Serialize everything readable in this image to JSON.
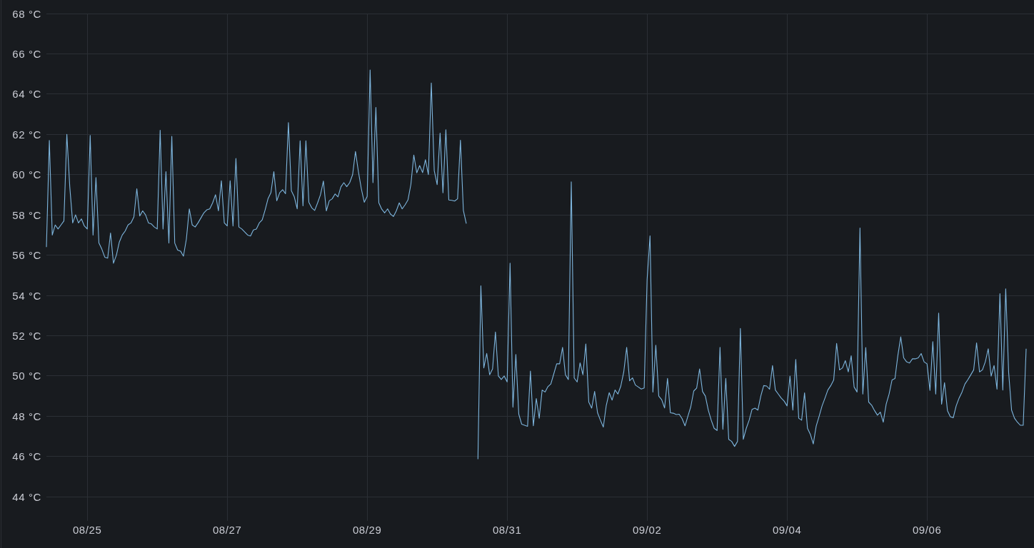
{
  "panel": {
    "chart_data": {
      "type": "line",
      "grid": true,
      "categories": [
        null,
        null,
        null,
        null,
        null,
        null,
        null,
        null,
        null,
        null,
        null,
        null,
        null,
        null,
        "08/25",
        null,
        null,
        null,
        null,
        null,
        null,
        null,
        null,
        null,
        null,
        null,
        null,
        null,
        null,
        null,
        null,
        null,
        null,
        null,
        null,
        null,
        null,
        null,
        null,
        null,
        null,
        null,
        null,
        null,
        null,
        null,
        null,
        null,
        null,
        null,
        null,
        null,
        null,
        null,
        null,
        null,
        null,
        null,
        null,
        null,
        null,
        null,
        "08/27",
        null,
        null,
        null,
        null,
        null,
        null,
        null,
        null,
        null,
        null,
        null,
        null,
        null,
        null,
        null,
        null,
        null,
        null,
        null,
        null,
        null,
        null,
        null,
        null,
        null,
        null,
        null,
        null,
        null,
        null,
        null,
        null,
        null,
        null,
        null,
        null,
        null,
        null,
        null,
        null,
        null,
        null,
        null,
        null,
        null,
        null,
        null,
        "08/29",
        null,
        null,
        null,
        null,
        null,
        null,
        null,
        null,
        null,
        null,
        null,
        null,
        null,
        null,
        null,
        null,
        null,
        null,
        null,
        null,
        null,
        null,
        null,
        null,
        null,
        null,
        null,
        null,
        null,
        null,
        null,
        null,
        null,
        null,
        null,
        null,
        null,
        null,
        null,
        null,
        null,
        null,
        null,
        null,
        null,
        null,
        null,
        "08/31",
        null,
        null,
        null,
        null,
        null,
        null,
        null,
        null,
        null,
        null,
        null,
        null,
        null,
        null,
        null,
        null,
        null,
        null,
        null,
        null,
        null,
        null,
        null,
        null,
        null,
        null,
        null,
        null,
        null,
        null,
        null,
        null,
        null,
        null,
        null,
        null,
        null,
        null,
        null,
        null,
        null,
        null,
        null,
        null,
        null,
        null,
        null,
        "09/02",
        null,
        null,
        null,
        null,
        null,
        null,
        null,
        null,
        null,
        null,
        null,
        null,
        null,
        null,
        null,
        null,
        null,
        null,
        null,
        null,
        null,
        null,
        null,
        null,
        null,
        null,
        null,
        null,
        null,
        null,
        null,
        null,
        null,
        null,
        null,
        null,
        null,
        null,
        null,
        null,
        null,
        null,
        null,
        null,
        null,
        null,
        null,
        "09/04",
        null,
        null,
        null,
        null,
        null,
        null,
        null,
        null,
        null,
        null,
        null,
        null,
        null,
        null,
        null,
        null,
        null,
        null,
        null,
        null,
        null,
        null,
        null,
        null,
        null,
        null,
        null,
        null,
        null,
        null,
        null,
        null,
        null,
        null,
        null,
        null,
        null,
        null,
        null,
        null,
        null,
        null,
        null,
        null,
        null,
        null,
        null,
        "09/06",
        null,
        null,
        null,
        null,
        null,
        null,
        null,
        null,
        null,
        null,
        null,
        null,
        null,
        null,
        null,
        null,
        null,
        null,
        null,
        null,
        null,
        null,
        null,
        null,
        null,
        null,
        null,
        null,
        null,
        null,
        null,
        null,
        null,
        null
      ],
      "series": [
        {
          "color": "#7eb6de",
          "values": [
            56.4,
            61.7,
            57.0,
            57.5,
            57.3,
            57.5,
            57.7,
            62.0,
            59.4,
            57.6,
            58.0,
            57.6,
            57.8,
            57.45,
            57.3,
            61.95,
            57.0,
            59.85,
            56.6,
            56.3,
            55.9,
            55.85,
            57.1,
            55.6,
            56.0,
            56.65,
            57.0,
            57.2,
            57.5,
            57.6,
            57.9,
            59.3,
            57.95,
            58.2,
            58.0,
            57.6,
            57.55,
            57.4,
            57.3,
            62.2,
            57.3,
            60.15,
            56.6,
            61.9,
            56.6,
            56.25,
            56.2,
            55.95,
            56.8,
            58.3,
            57.5,
            57.4,
            57.6,
            57.85,
            58.1,
            58.25,
            58.3,
            58.6,
            59.0,
            58.2,
            59.7,
            57.6,
            57.45,
            59.7,
            57.45,
            60.8,
            57.4,
            57.3,
            57.15,
            57.0,
            56.95,
            57.25,
            57.3,
            57.6,
            57.75,
            58.25,
            58.8,
            59.1,
            60.15,
            58.7,
            59.1,
            59.25,
            59.05,
            62.58,
            59.2,
            58.9,
            58.3,
            61.68,
            58.45,
            61.68,
            58.63,
            58.35,
            58.22,
            58.6,
            59.0,
            59.68,
            58.2,
            58.7,
            58.8,
            59.04,
            58.9,
            59.39,
            59.6,
            59.4,
            59.6,
            60.0,
            61.15,
            60.15,
            59.3,
            58.63,
            58.92,
            65.2,
            59.6,
            63.34,
            58.6,
            58.28,
            58.1,
            58.3,
            58.04,
            57.92,
            58.2,
            58.6,
            58.3,
            58.5,
            58.74,
            59.51,
            60.97,
            60.09,
            60.45,
            60.1,
            60.74,
            60.0,
            64.55,
            60.2,
            59.5,
            62.06,
            59.1,
            62.23,
            58.74,
            58.72,
            58.69,
            58.8,
            61.71,
            58.22,
            57.57,
            null,
            null,
            null,
            45.87,
            54.48,
            50.4,
            51.12,
            50.06,
            50.35,
            52.18,
            50.0,
            49.82,
            50.0,
            49.7,
            55.6,
            48.45,
            51.06,
            48.1,
            47.6,
            47.55,
            47.5,
            50.24,
            47.52,
            48.88,
            47.9,
            49.3,
            49.2,
            49.47,
            49.6,
            50.1,
            50.6,
            50.6,
            51.42,
            50.06,
            49.82,
            59.64,
            49.9,
            49.7,
            50.65,
            50.06,
            51.59,
            48.7,
            48.4,
            49.23,
            48.17,
            47.8,
            47.46,
            48.53,
            49.17,
            48.8,
            49.3,
            49.1,
            49.5,
            50.2,
            51.42,
            49.76,
            49.9,
            49.55,
            49.45,
            49.35,
            49.4,
            54.78,
            56.96,
            49.2,
            51.53,
            49.0,
            48.82,
            48.41,
            49.88,
            48.17,
            48.15,
            48.08,
            48.1,
            47.88,
            47.52,
            48.0,
            48.47,
            49.25,
            49.4,
            50.35,
            49.23,
            49.0,
            48.3,
            47.8,
            47.4,
            47.29,
            51.42,
            47.35,
            49.88,
            46.85,
            46.75,
            46.5,
            46.75,
            52.36,
            46.85,
            47.39,
            47.8,
            48.34,
            48.4,
            48.3,
            49.0,
            49.52,
            49.5,
            49.34,
            50.52,
            49.3,
            49.1,
            48.9,
            48.75,
            48.51,
            49.99,
            48.3,
            50.82,
            47.9,
            47.8,
            49.16,
            47.4,
            47.1,
            46.62,
            47.51,
            48.0,
            48.51,
            48.9,
            49.3,
            49.52,
            49.8,
            51.61,
            50.3,
            50.4,
            50.76,
            50.2,
            51.0,
            49.45,
            49.2,
            57.35,
            49.1,
            51.41,
            48.7,
            48.55,
            48.28,
            48.05,
            48.2,
            47.7,
            48.6,
            49.1,
            49.8,
            49.87,
            51.0,
            51.94,
            50.9,
            50.7,
            50.64,
            50.85,
            50.85,
            50.9,
            51.11,
            50.7,
            50.6,
            49.28,
            51.7,
            49.1,
            53.12,
            48.6,
            49.67,
            48.28,
            47.98,
            47.92,
            48.51,
            48.9,
            49.2,
            49.6,
            49.81,
            50.05,
            50.3,
            51.64,
            50.2,
            50.3,
            50.7,
            51.35,
            49.99,
            50.52,
            49.34,
            54.09,
            49.3,
            54.33,
            50.17,
            48.3,
            47.9,
            47.7,
            47.55,
            47.55,
            51.35
          ]
        }
      ],
      "ylim": [
        42.8,
        68
      ],
      "yticks": [
        {
          "value": 68,
          "label": "68 °C"
        },
        {
          "value": 66,
          "label": "66 °C"
        },
        {
          "value": 64,
          "label": "64 °C"
        },
        {
          "value": 62,
          "label": "62 °C"
        },
        {
          "value": 60,
          "label": "60 °C"
        },
        {
          "value": 58,
          "label": "58 °C"
        },
        {
          "value": 56,
          "label": "56 °C"
        },
        {
          "value": 54,
          "label": "54 °C"
        },
        {
          "value": 52,
          "label": "52 °C"
        },
        {
          "value": 50,
          "label": "50 °C"
        },
        {
          "value": 48,
          "label": "48 °C"
        },
        {
          "value": 46,
          "label": "46 °C"
        },
        {
          "value": 44,
          "label": "44 °C"
        }
      ]
    }
  }
}
